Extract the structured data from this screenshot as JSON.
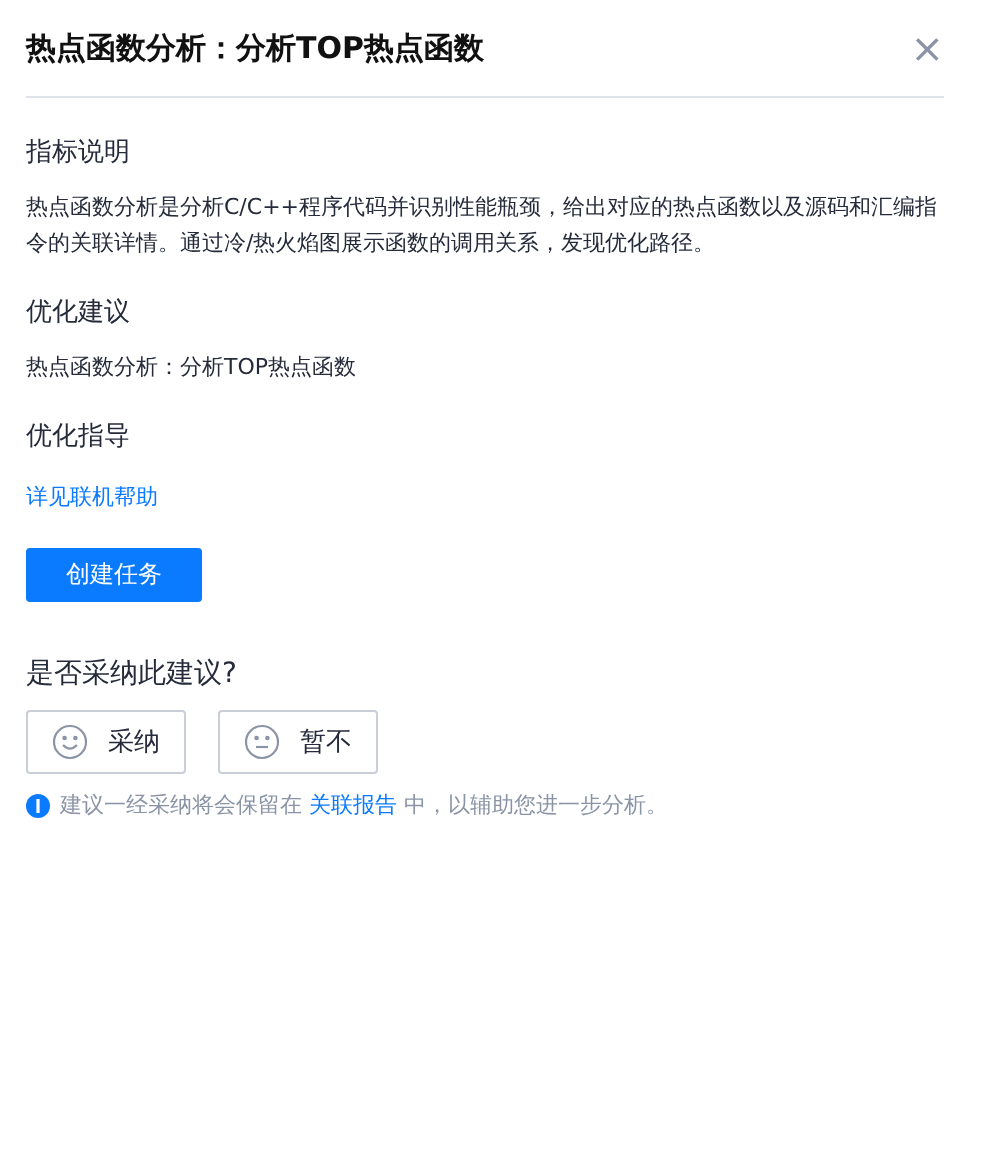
{
  "dialog": {
    "title": "热点函数分析：分析TOP热点函数",
    "close": "×"
  },
  "sections": [
    {
      "heading": "指标说明",
      "kind": "text",
      "body": "热点函数分析是分析C/C++程序代码并识别性能瓶颈，给出对应的热点函数以及源码和汇编指令的关联详情。通过冷/热火焰图展示函数的调用关系，发现优化路径。"
    },
    {
      "heading": "优化建议",
      "kind": "text",
      "body": "热点函数分析：分析TOP热点函数"
    },
    {
      "heading": "优化指导",
      "kind": "link",
      "body": "详见联机帮助"
    }
  ],
  "primary_button": "创建任务",
  "feedback": {
    "question": "是否采纳此建议?",
    "options": [
      {
        "label": "采纳",
        "kind": "smile"
      },
      {
        "label": "暂不",
        "kind": "neutral"
      }
    ],
    "note": {
      "before": "建议一经采纳将会保留在 ",
      "link": "关联报告",
      "after": " 中，以辅助您进一步分析。"
    }
  }
}
